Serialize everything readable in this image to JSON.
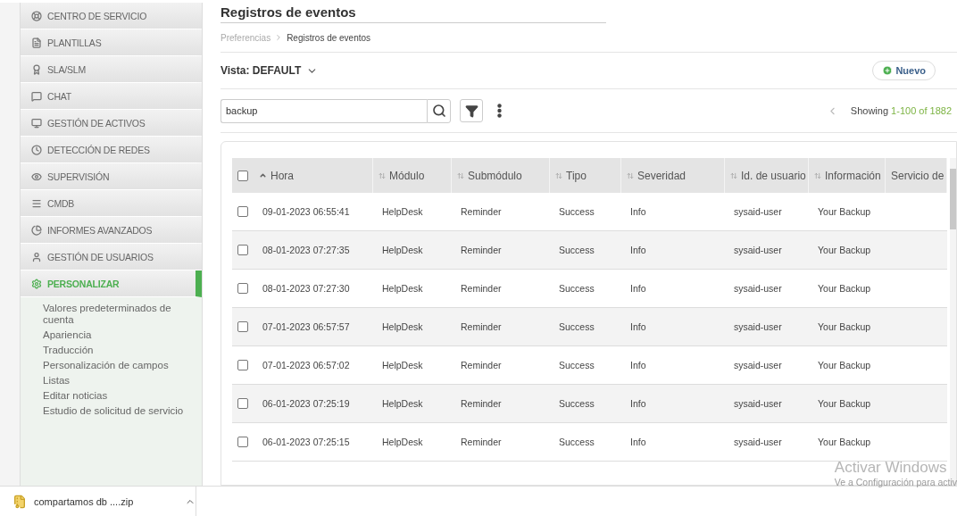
{
  "sidebar": {
    "items": [
      {
        "label": "CENTRO DE SERVICIO",
        "selected": false
      },
      {
        "label": "PLANTILLAS",
        "selected": false
      },
      {
        "label": "SLA/SLM",
        "selected": false
      },
      {
        "label": "CHAT",
        "selected": false
      },
      {
        "label": "GESTIÓN DE ACTIVOS",
        "selected": false
      },
      {
        "label": "DETECCIÓN DE REDES",
        "selected": false
      },
      {
        "label": "SUPERVISIÓN",
        "selected": false
      },
      {
        "label": "CMDB",
        "selected": false
      },
      {
        "label": "INFORMES AVANZADOS",
        "selected": false
      },
      {
        "label": "GESTIÓN DE USUARIOS",
        "selected": false
      },
      {
        "label": "PERSONALIZAR",
        "selected": true,
        "children": [
          {
            "label": "Valores predeterminados de cuenta"
          },
          {
            "label": "Apariencia"
          },
          {
            "label": "Traducción"
          },
          {
            "label": "Personalización de campos"
          },
          {
            "label": "Listas"
          },
          {
            "label": "Editar noticias"
          },
          {
            "label": "Estudio de solicitud de servicio"
          }
        ]
      }
    ]
  },
  "page": {
    "title": "Registros de eventos",
    "breadcrumb": [
      {
        "label": "Preferencias",
        "current": false
      },
      {
        "label": "Registros de eventos",
        "current": true
      }
    ],
    "view": "Vista: DEFAULT",
    "new_button": "Nuevo",
    "search": {
      "value": "backup"
    },
    "pagination": {
      "prefix": "Showing",
      "range": "1-100 of 1882"
    }
  },
  "table": {
    "select_all": {
      "checked": false
    },
    "columns": [
      {
        "label": "Hora",
        "kind": "sorted"
      },
      {
        "label": "Módulo",
        "kind": "sortable"
      },
      {
        "label": "Submódulo",
        "kind": "sortable"
      },
      {
        "label": "Tipo",
        "kind": "sortable"
      },
      {
        "label": "Severidad",
        "kind": "sortable"
      },
      {
        "label": "Id. de usuario",
        "kind": "sortable"
      },
      {
        "label": "Información",
        "kind": "sortable"
      },
      {
        "label": "Servicio de",
        "kind": "plain"
      }
    ],
    "rows": [
      {
        "checked": false,
        "cells": [
          "09-01-2023 06:55:41",
          "HelpDesk",
          "Reminder",
          "Success",
          "Info",
          "sysaid-user",
          "Your Backup"
        ]
      },
      {
        "checked": false,
        "cells": [
          "08-01-2023 07:27:35",
          "HelpDesk",
          "Reminder",
          "Success",
          "Info",
          "sysaid-user",
          "Your Backup"
        ]
      },
      {
        "checked": false,
        "cells": [
          "08-01-2023 07:27:30",
          "HelpDesk",
          "Reminder",
          "Success",
          "Info",
          "sysaid-user",
          "Your Backup"
        ]
      },
      {
        "checked": false,
        "cells": [
          "07-01-2023 06:57:57",
          "HelpDesk",
          "Reminder",
          "Success",
          "Info",
          "sysaid-user",
          "Your Backup"
        ]
      },
      {
        "checked": false,
        "cells": [
          "07-01-2023 06:57:02",
          "HelpDesk",
          "Reminder",
          "Success",
          "Info",
          "sysaid-user",
          "Your Backup"
        ]
      },
      {
        "checked": false,
        "cells": [
          "06-01-2023 07:25:19",
          "HelpDesk",
          "Reminder",
          "Success",
          "Info",
          "sysaid-user",
          "Your Backup"
        ]
      },
      {
        "checked": false,
        "cells": [
          "06-01-2023 07:25:15",
          "HelpDesk",
          "Reminder",
          "Success",
          "Info",
          "sysaid-user",
          "Your Backup"
        ]
      }
    ]
  },
  "windows_notice": {
    "title": "Activar Windows",
    "text": "Ve a Configuración para activ"
  },
  "download_bar": {
    "file": "compartamos db ....zip"
  }
}
